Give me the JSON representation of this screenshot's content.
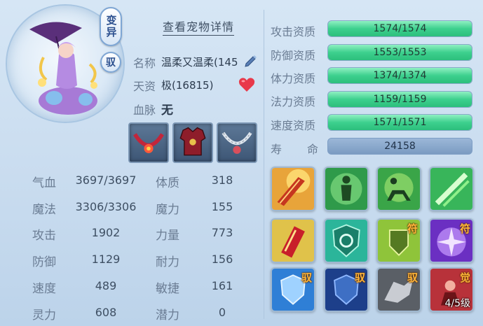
{
  "pet": {
    "variant_badge": "变异",
    "ride_badge": "驭",
    "detail_link": "查看宠物详情",
    "name_label": "名称",
    "name_value": "温柔又温柔(145",
    "talent_label": "天资",
    "talent_value": "极(16815)",
    "blood_label": "血脉",
    "blood_value": "无",
    "equipment": [
      "necklace-red",
      "armor-red",
      "collar-silver"
    ]
  },
  "stats_left": [
    {
      "label": "气血",
      "value": "3697/3697"
    },
    {
      "label": "魔法",
      "value": "3306/3306"
    },
    {
      "label": "攻击",
      "value": "1902"
    },
    {
      "label": "防御",
      "value": "1129"
    },
    {
      "label": "速度",
      "value": "489"
    },
    {
      "label": "灵力",
      "value": "608"
    }
  ],
  "stats_right": [
    {
      "label": "体质",
      "value": "318"
    },
    {
      "label": "魔力",
      "value": "155"
    },
    {
      "label": "力量",
      "value": "773"
    },
    {
      "label": "耐力",
      "value": "156"
    },
    {
      "label": "敏捷",
      "value": "161"
    },
    {
      "label": "潜力",
      "value": "0"
    }
  ],
  "qualities": [
    {
      "label": "攻击资质",
      "value": "1574/1574",
      "fill": 1.0
    },
    {
      "label": "防御资质",
      "value": "1553/1553",
      "fill": 1.0
    },
    {
      "label": "体力资质",
      "value": "1374/1374",
      "fill": 1.0
    },
    {
      "label": "法力资质",
      "value": "1159/1159",
      "fill": 1.0
    },
    {
      "label": "速度资质",
      "value": "1571/1571",
      "fill": 1.0
    }
  ],
  "life": {
    "label_a": "寿",
    "label_b": "命",
    "value": "24158"
  },
  "skills": [
    {
      "icon": "sword-strike-icon",
      "tag": ""
    },
    {
      "icon": "green-figure-icon",
      "tag": ""
    },
    {
      "icon": "centaur-icon",
      "tag": ""
    },
    {
      "icon": "green-light-icon",
      "tag": ""
    },
    {
      "icon": "red-blade-icon",
      "tag": ""
    },
    {
      "icon": "shield-swirl-icon",
      "tag": ""
    },
    {
      "icon": "armor-talisman-icon",
      "tag": "符"
    },
    {
      "icon": "purple-burst-icon",
      "tag": "符"
    },
    {
      "icon": "blue-shield-icon",
      "tag": "驭"
    },
    {
      "icon": "dark-shield-icon",
      "tag": "驭"
    },
    {
      "icon": "grey-beast-icon",
      "tag": "驭"
    },
    {
      "icon": "awaken-warrior-icon",
      "tag": "觉",
      "level": "4/5级"
    }
  ],
  "colors": {
    "quality_fill": "#3dd08e",
    "life_bar": "#7b9bc2",
    "background": "#c9dcef"
  }
}
